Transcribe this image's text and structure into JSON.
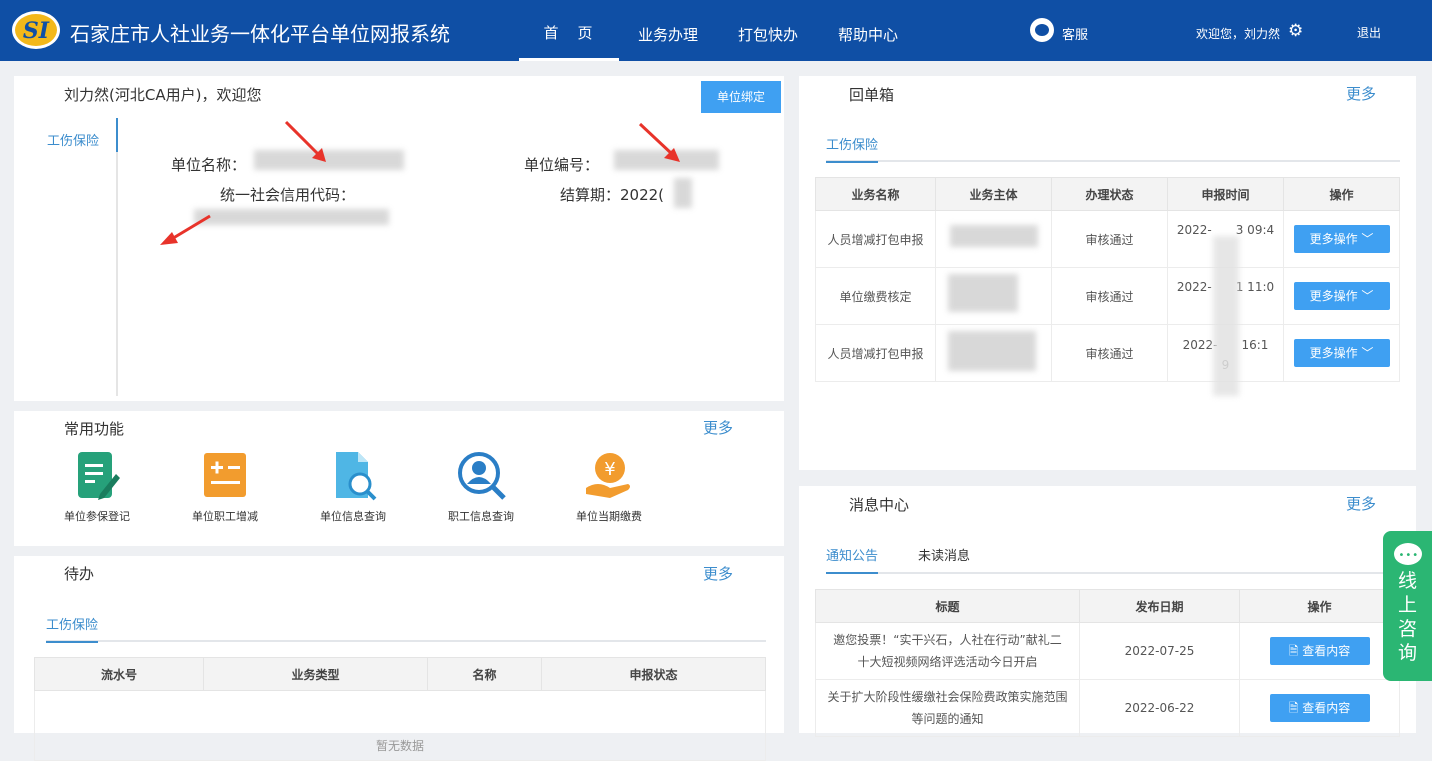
{
  "header": {
    "logo_text": "SI",
    "title": "石家庄市人社业务一体化平台单位网报系统",
    "nav": [
      "首　页",
      "业务办理",
      "打包快办",
      "帮助中心"
    ],
    "service": "客服",
    "welcome": "欢迎您，刘力然",
    "logout": "退出"
  },
  "profile": {
    "greeting": "刘力然(河北CA用户)，欢迎您",
    "bind_button": "单位绑定",
    "side_tab": "工伤保险",
    "unit_name_label": "单位名称：",
    "unit_no_label": "单位编号：",
    "credit_code_label": "统一社会信用代码：",
    "settle_label": "结算期：2022("
  },
  "common": {
    "title": "常用功能",
    "more": "更多",
    "items": [
      {
        "label": "单位参保登记",
        "icon": "register-icon"
      },
      {
        "label": "单位职工增减",
        "icon": "staff-change-icon"
      },
      {
        "label": "单位信息查询",
        "icon": "unit-query-icon"
      },
      {
        "label": "职工信息查询",
        "icon": "staff-query-icon"
      },
      {
        "label": "单位当期缴费",
        "icon": "payment-icon"
      }
    ]
  },
  "todo": {
    "title": "待办",
    "more": "更多",
    "tab": "工伤保险",
    "columns": [
      "流水号",
      "业务类型",
      "名称",
      "申报状态"
    ],
    "empty": "暂无数据"
  },
  "receipt": {
    "title": "回单箱",
    "more": "更多",
    "tab": "工伤保险",
    "columns": [
      "业务名称",
      "业务主体",
      "办理状态",
      "申报时间",
      "操作"
    ],
    "rows": [
      {
        "name": "人员增减打包申报",
        "status": "审核通过",
        "time": "2022-　　3 09:4",
        "action": "更多操作 ﹀"
      },
      {
        "name": "单位缴费核定",
        "status": "审核通过",
        "time": "2022-　　1 11:0",
        "action": "更多操作 ﹀"
      },
      {
        "name": "人员增减打包申报",
        "status": "审核通过",
        "time": "2022-　　16:1",
        "time2": "9",
        "action": "更多操作 ﹀"
      }
    ]
  },
  "messages": {
    "title": "消息中心",
    "more": "更多",
    "tab_active": "通知公告",
    "tab_other": "未读消息",
    "columns": [
      "标题",
      "发布日期",
      "操作"
    ],
    "rows": [
      {
        "title1": "邀您投票！“实干兴石，人社在行动”献礼二",
        "title2": "十大短视频网络评选活动今日开启",
        "date": "2022-07-25",
        "action": "查看内容"
      },
      {
        "title1": "关于扩大阶段性缓缴社会保险费政策实施范围",
        "title2": "等问题的通知",
        "date": "2022-06-22",
        "action": "查看内容"
      }
    ]
  },
  "float": {
    "chars": [
      "线",
      "上",
      "咨",
      "询"
    ]
  },
  "colors": {
    "header": "#0f4fa5",
    "accent": "#3c8dcd",
    "button": "#3fa0f2",
    "consult": "#2bb673"
  }
}
